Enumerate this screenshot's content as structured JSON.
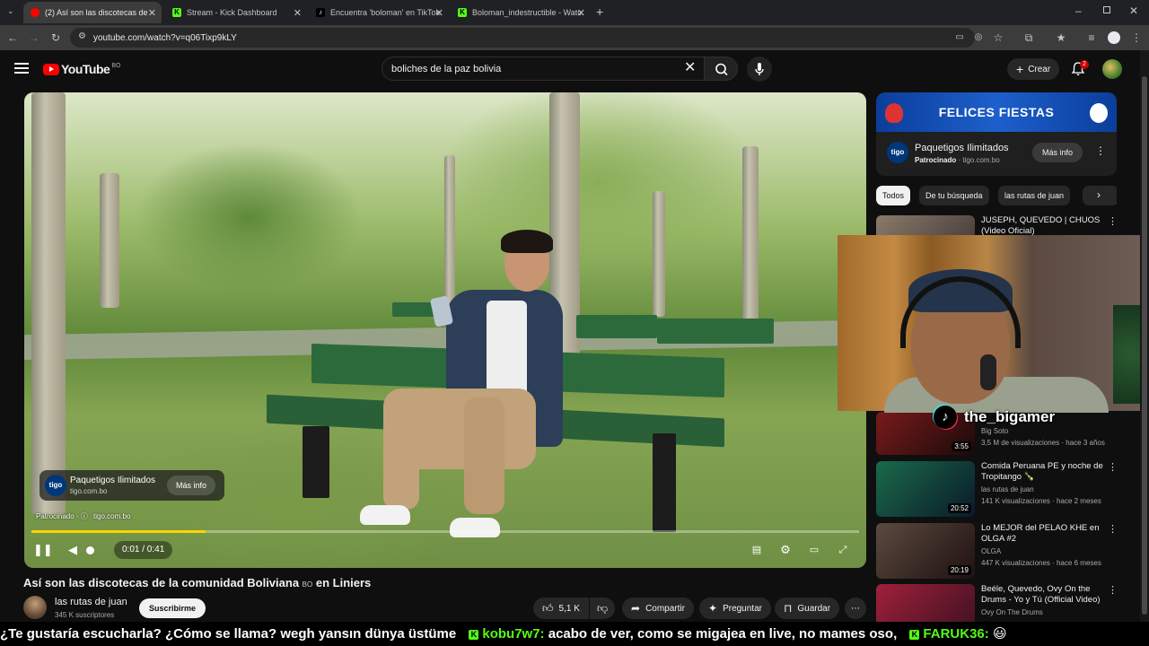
{
  "browser": {
    "tabs": [
      {
        "label": "(2) Así son las discotecas de",
        "active": true
      },
      {
        "label": "Stream - Kick Dashboard",
        "active": false
      },
      {
        "label": "Encuentra 'boloman' en TikTok",
        "active": false
      },
      {
        "label": "Boloman_indestructible - Watc",
        "active": false
      }
    ],
    "url": "youtube.com/watch?v=q06Tixp9kLY"
  },
  "header": {
    "logo_text": "YouTube",
    "country_code": "BO",
    "search_value": "boliches de la paz bolivia",
    "create_label": "Crear",
    "notification_count": "2"
  },
  "player": {
    "ad_name": "Paquetigos Ilimitados",
    "ad_domain": "tigo.com.bo",
    "ad_more_label": "Más info",
    "ad_logo_text": "tigo",
    "sponsored_label": "Patrocinado · ⓘ",
    "sponsored_domain": "tigo.com.bo",
    "time": "0:01 / 0:41",
    "progress": 0.21
  },
  "video": {
    "title": "Así son las discotecas de la comunidad Boliviana",
    "title_flag": "BO",
    "title_suffix": "en Liniers",
    "channel": "las rutas de juan",
    "subscribers": "345 K suscriptores",
    "subscribe_label": "Suscribirme",
    "likes": "5,1 K",
    "share_label": "Compartir",
    "ask_label": "Preguntar",
    "save_label": "Guardar"
  },
  "sidebar_ad": {
    "banner": "FELICES FIESTAS",
    "name": "Paquetigos Ilimitados",
    "sponsored": "Patrocinado",
    "domain": "tigo.com.bo",
    "more_label": "Más info",
    "logo_text": "tigo"
  },
  "chips": [
    "Todos",
    "De tu búsqueda",
    "las rutas de juan"
  ],
  "recommendations": [
    {
      "title": "JUSEPH, QUEVEDO | CHUOS (Video Oficial)",
      "channel": "",
      "meta": "",
      "duration": ""
    },
    {
      "title": "",
      "channel": "Big Soto",
      "meta": "3,5 M de visualizaciones · hace 3 años",
      "duration": "3:55"
    },
    {
      "title": "Comida Peruana PE y noche de Tropitango 🍾",
      "channel": "las rutas de juan",
      "meta": "141 K visualizaciones · hace 2 meses",
      "duration": "20:52"
    },
    {
      "title": "Lo MEJOR del PELAO KHE en OLGA #2",
      "channel": "OLGA",
      "meta": "447 K visualizaciones · hace 6 meses",
      "duration": "20:19"
    },
    {
      "title": "Beéle, Quevedo, Ovy On the Drums - Yo y Tú (Official Video)",
      "channel": "Ovy On The Drums",
      "meta": "",
      "duration": ""
    }
  ],
  "overlay": {
    "streamer": "the_bigamer"
  },
  "ticker": {
    "segments": [
      {
        "user": "",
        "text": "¿Te gustaría escucharla? ¿Cómo se llama? wegh yansın dünya üstüme"
      },
      {
        "user": "kobu7w7:",
        "text": "acabo de ver, como se migajea en live, no mames oso,"
      },
      {
        "user": "FARUK36:",
        "text": "😃"
      }
    ]
  },
  "colors": {
    "background": "#0f0f0f",
    "youtube_red": "#ff0000",
    "progress_yellow": "#ffd400",
    "kick_green": "#53fc18"
  },
  "icons": [
    "menu-icon",
    "search-icon",
    "clear-icon",
    "mic-icon",
    "bell-icon",
    "pause-icon",
    "volume-icon",
    "captions-icon",
    "settings-icon",
    "theater-icon",
    "fullscreen-icon",
    "like-icon",
    "dislike-icon",
    "share-icon",
    "ask-icon",
    "save-icon",
    "more-icon"
  ]
}
